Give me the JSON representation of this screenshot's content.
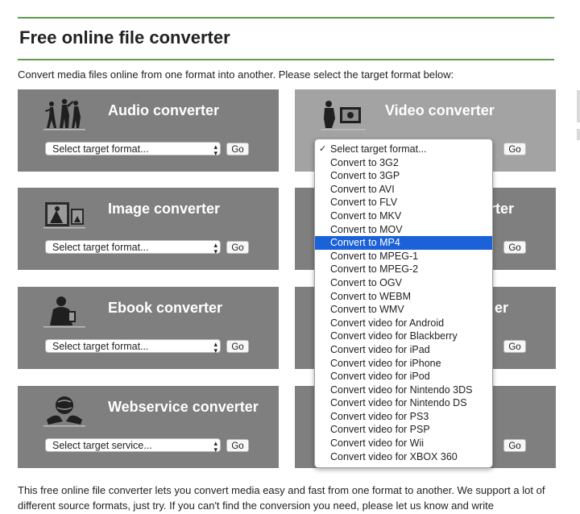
{
  "page": {
    "title": "Free online file converter",
    "intro": "Convert media files online from one format into another. Please select the target format below:",
    "footer": "This free online file converter lets you convert media easy and fast from one format to another. We support a lot of different source formats, just try. If you can't find the conversion you need, please let us know and write"
  },
  "cards": {
    "audio": {
      "title": "Audio converter",
      "select": "Select target format...",
      "go": "Go"
    },
    "video": {
      "title": "Video converter",
      "go": "Go"
    },
    "image": {
      "title": "Image converter",
      "select": "Select target format...",
      "go": "Go"
    },
    "document": {
      "title_fragment": "rter",
      "go": "Go"
    },
    "ebook": {
      "title": "Ebook converter",
      "select": "Select target format...",
      "go": "Go"
    },
    "archive": {
      "title_fragment": "er",
      "go": "Go"
    },
    "webservice": {
      "title": "Webservice converter",
      "select": "Select target service...",
      "go": "Go"
    },
    "hash": {
      "go": "Go"
    }
  },
  "dropdown": {
    "options": [
      "Select target format...",
      "Convert to 3G2",
      "Convert to 3GP",
      "Convert to AVI",
      "Convert to FLV",
      "Convert to MKV",
      "Convert to MOV",
      "Convert to MP4",
      "Convert to MPEG-1",
      "Convert to MPEG-2",
      "Convert to OGV",
      "Convert to WEBM",
      "Convert to WMV",
      "Convert video for Android",
      "Convert video for Blackberry",
      "Convert video for iPad",
      "Convert video for iPhone",
      "Convert video for iPod",
      "Convert video for Nintendo 3DS",
      "Convert video for Nintendo DS",
      "Convert video for PS3",
      "Convert video for PSP",
      "Convert video for Wii",
      "Convert video for XBOX 360"
    ],
    "checked": "Select target format...",
    "highlighted": "Convert to MP4"
  },
  "colors": {
    "accent_line": "#5f9a4f",
    "card_bg": "#7f7f7f",
    "highlight": "#1b61d8"
  }
}
